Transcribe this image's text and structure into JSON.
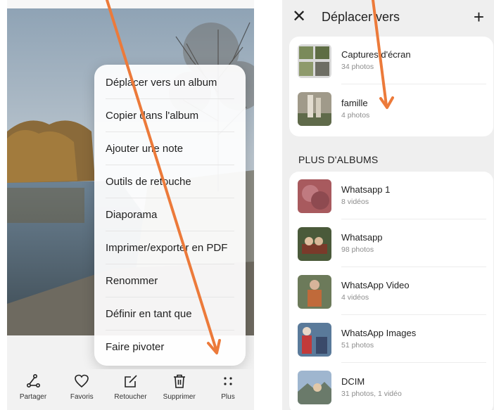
{
  "left_screen": {
    "context_menu": {
      "items": [
        "Déplacer vers un album",
        "Copier dans l'album",
        "Ajouter une note",
        "Outils de retouche",
        "Diaporama",
        "Imprimer/exporter en PDF",
        "Renommer",
        "Définir en tant que",
        "Faire pivoter"
      ]
    },
    "bottom_bar": {
      "share": "Partager",
      "favorites": "Favoris",
      "edit": "Retoucher",
      "delete": "Supprimer",
      "more": "Plus"
    }
  },
  "right_screen": {
    "header": {
      "close_icon": "close-icon",
      "title": "Déplacer vers",
      "add_icon": "plus-icon"
    },
    "recent_albums": [
      {
        "name": "Captures d'écran",
        "count": "34 photos"
      },
      {
        "name": "famille",
        "count": "4 photos"
      }
    ],
    "more_albums_title": "PLUS D'ALBUMS",
    "more_albums": [
      {
        "name": "Whatsapp 1",
        "count": "8 vidéos"
      },
      {
        "name": "Whatsapp",
        "count": "98 photos"
      },
      {
        "name": "WhatsApp Video",
        "count": "4 vidéos"
      },
      {
        "name": "WhatsApp Images",
        "count": "51 photos"
      },
      {
        "name": "DCIM",
        "count": "31 photos, 1 vidéo"
      }
    ]
  },
  "colors": {
    "annotation_arrow": "#ec7a3a",
    "card_bg": "#ffffff",
    "screen_bg": "#efefef"
  }
}
